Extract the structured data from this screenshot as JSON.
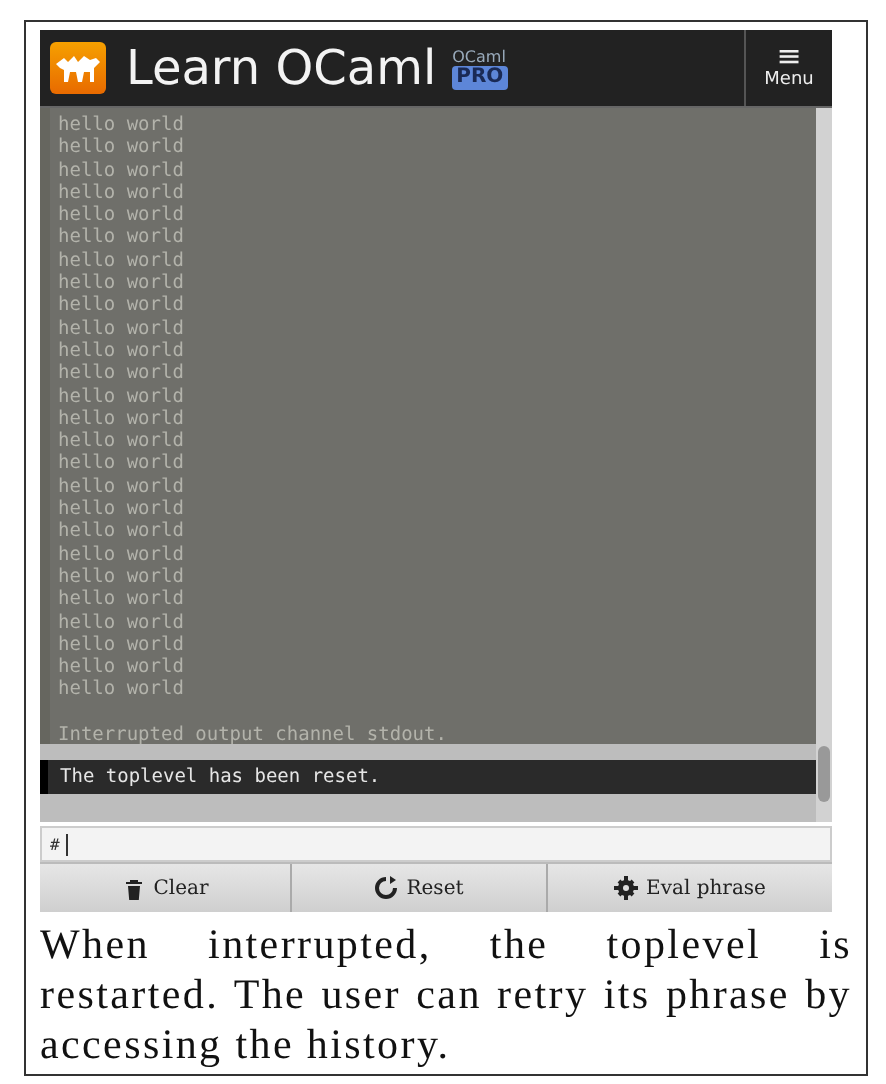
{
  "header": {
    "title": "Learn OCaml",
    "badge_top": "OCaml",
    "badge": "PRO",
    "menu": {
      "icon": "≡",
      "label": "Menu"
    }
  },
  "output": {
    "lines": [
      "hello world",
      "hello world",
      "hello world",
      "hello world",
      "hello world",
      "hello world",
      "hello world",
      "hello world",
      "hello world",
      "hello world",
      "hello world",
      "hello world",
      "hello world",
      "hello world",
      "hello world",
      "hello world",
      "hello world",
      "hello world",
      "hello world",
      "hello world",
      "hello world",
      "hello world",
      "hello world",
      "hello world",
      "hello world",
      "hello world"
    ],
    "notice": "Interrupted output channel stdout.",
    "reset_message": "The toplevel has been reset."
  },
  "prompt": {
    "symbol": "#"
  },
  "buttons": [
    {
      "label": "Clear"
    },
    {
      "label": "Reset"
    },
    {
      "label": "Eval phrase"
    }
  ],
  "caption": "When interrupted, the toplevel is restarted. The user can retry its phrase by accessing the history."
}
